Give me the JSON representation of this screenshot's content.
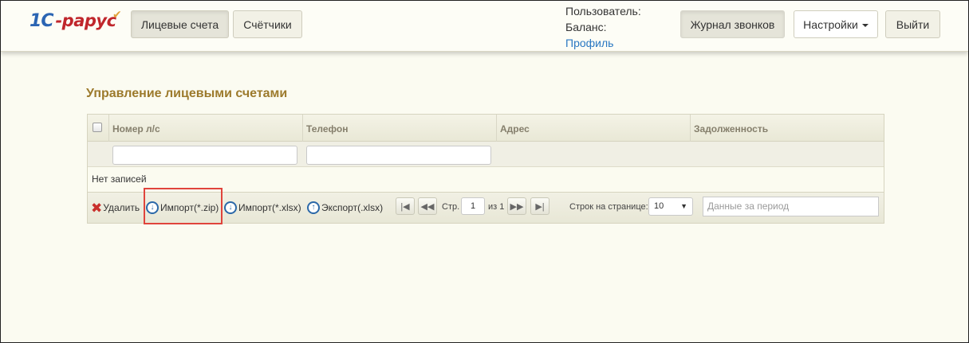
{
  "header": {
    "logo_text": "1С-Рарус",
    "tabs": [
      {
        "label": "Лицевые счета",
        "active": true
      },
      {
        "label": "Счётчики",
        "active": false
      }
    ],
    "user": {
      "user_label": "Пользователь:",
      "balance_label": "Баланс:",
      "profile_link": "Профиль"
    },
    "call_log_button": "Журнал звонков",
    "settings_button": "Настройки",
    "logout_button": "Выйти"
  },
  "main": {
    "title": "Управление лицевыми счетами",
    "grid": {
      "columns": [
        "Номер л/с",
        "Телефон",
        "Адрес",
        "Задолженность"
      ],
      "empty_text": "Нет записей"
    },
    "toolbar": {
      "delete_label": "Удалить",
      "import_zip_label": "Импорт(*.zip)",
      "import_xlsx_label": "Импорт(*.xlsx)",
      "export_xlsx_label": "Экспорт(.xlsx)"
    },
    "pager": {
      "page_label": "Стр.",
      "page_value": "1",
      "of_label": "из 1",
      "rows_label": "Строк на странице:",
      "rows_value": "10",
      "period_placeholder": "Данные за период"
    }
  },
  "colors": {
    "accent_title": "#9c7a2c",
    "link": "#2a78c2",
    "highlight": "#e0443c",
    "background": "#fbfbf1"
  },
  "icons": [
    "delete-icon",
    "download-icon",
    "upload-icon",
    "first-page-icon",
    "prev-page-icon",
    "next-page-icon",
    "last-page-icon"
  ]
}
